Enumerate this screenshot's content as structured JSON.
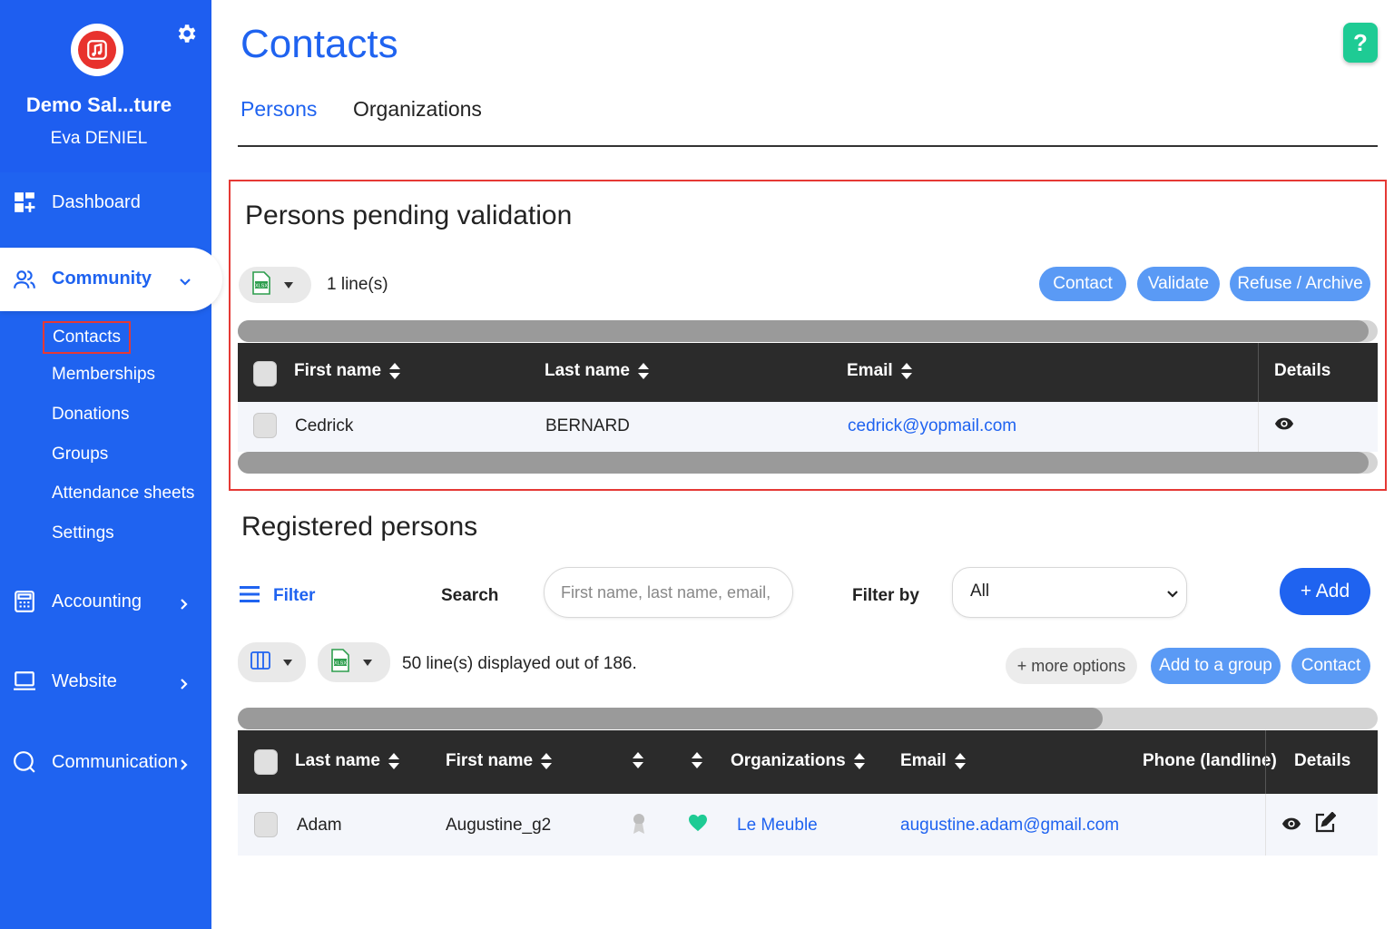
{
  "sidebar": {
    "org_name": "Demo Sal...ture",
    "user_name": "Eva DENIEL",
    "nav": {
      "dashboard": "Dashboard",
      "community": "Community",
      "accounting": "Accounting",
      "website": "Website",
      "communication": "Communication"
    },
    "community_items": [
      "Contacts",
      "Memberships",
      "Donations",
      "Groups",
      "Attendance sheets",
      "Settings"
    ]
  },
  "header": {
    "title": "Contacts",
    "help": "?"
  },
  "tabs": [
    "Persons",
    "Organizations"
  ],
  "pending": {
    "title": "Persons pending validation",
    "line_count": "1 line(s)",
    "buttons": [
      "Contact",
      "Validate",
      "Refuse / Archive"
    ],
    "columns": [
      "First name",
      "Last name",
      "Email",
      "Details"
    ],
    "rows": [
      {
        "first_name": "Cedrick",
        "last_name": "BERNARD",
        "email": "cedrick@yopmail.com"
      }
    ]
  },
  "registered": {
    "title": "Registered persons",
    "filter_label": "Filter",
    "search_label": "Search",
    "search_placeholder": "First name, last name, email, ...",
    "filter_by_label": "Filter by",
    "filter_by_value": "All",
    "add_label": "+ Add",
    "line_count": "50 line(s) displayed out of 186.",
    "more_options": "+ more options",
    "buttons": [
      "Add to a group",
      "Contact"
    ],
    "columns": [
      "Last name",
      "First name",
      "Organizations",
      "Email",
      "Phone (landline)",
      "Details"
    ],
    "rows": [
      {
        "last_name": "Adam",
        "first_name": "Augustine_g2",
        "organization": "Le Meuble",
        "email": "augustine.adam@gmail.com",
        "phone": ""
      }
    ]
  },
  "colors": {
    "primary": "#1f63f0",
    "sidebar": "#1f63f0",
    "button_light": "#5a9af5",
    "table_header": "#2b2b2b",
    "highlight": "#e53935",
    "help": "#1ecb94",
    "heart": "#1ecb94"
  },
  "icons": {
    "gear": "gear-icon",
    "dashboard": "dashboard-icon",
    "community": "users-icon",
    "accounting": "calculator-icon",
    "website": "monitor-icon",
    "communication": "chat-icon",
    "export": "xlsx-icon",
    "columns": "columns-icon",
    "details": "eye-icon",
    "edit": "edit-icon",
    "badge": "ribbon-icon",
    "favorite": "heart-icon"
  }
}
